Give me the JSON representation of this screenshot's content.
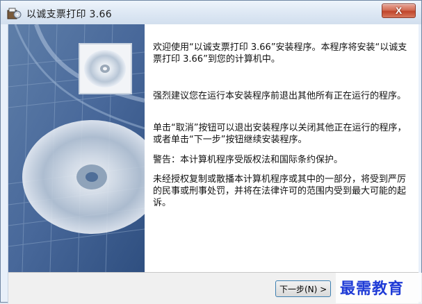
{
  "window": {
    "title": "以诚支票打印 3.66",
    "close_label": "X"
  },
  "content": {
    "paragraphs": [
      "欢迎使用“以诚支票打印 3.66”安装程序。本程序将安装“以诚支票打印 3.66”到您的计算机中。",
      "强烈建议您在运行本安装程序前退出其他所有正在运行的程序。",
      "单击“取消”按钮可以退出安装程序以关闭其他正在运行的程序，或者单击“下一步”按钮继续安装程序。",
      "警告：本计算机程序受版权法和国际条约保护。",
      "未经授权复制或散播本计算机程序或其中的一部分，将受到严厉的民事或刑事处罚，并将在法律许可的范围内受到最大可能的起诉。"
    ]
  },
  "buttons": {
    "next_label": "下一步(N) >"
  },
  "watermark": {
    "text": "最需教育"
  },
  "icons": {
    "app": "installer-icon",
    "banner": "cd-disc-icon"
  }
}
